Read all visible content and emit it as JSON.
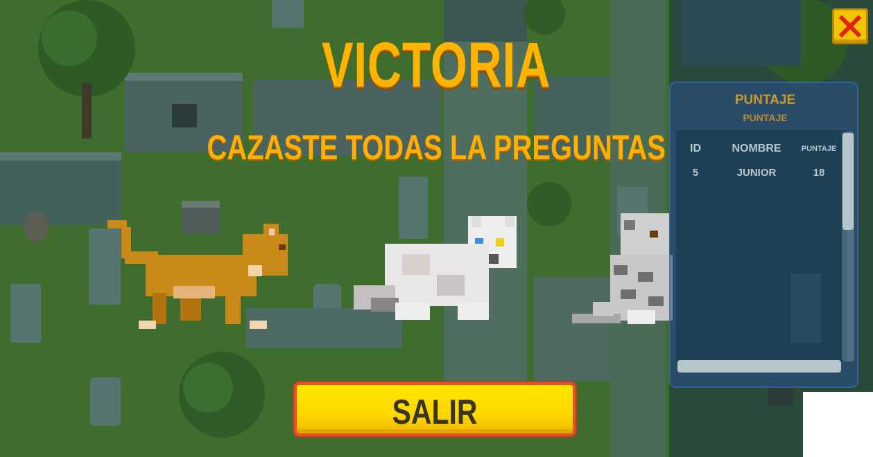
{
  "screen": {
    "title": "VICTORIA",
    "subtitle": "CAZASTE TODAS LA PREGUNTAS",
    "exit_label": "SALIR"
  },
  "close_button": {
    "icon": "close-icon",
    "color": "#f5c400",
    "x_color": "#e0201a"
  },
  "score_panel": {
    "title": "PUNTAJE",
    "subtitle": "PUNTAJE",
    "columns": [
      "ID",
      "NOMBRE",
      "PUNTAJE"
    ],
    "rows": [
      {
        "id": "5",
        "nombre": "JUNIOR",
        "puntaje": "18"
      }
    ]
  },
  "characters": [
    "orange-cat",
    "white-cat",
    "gray-tabby-cat"
  ],
  "colors": {
    "title": "#ffb400",
    "exit_button": "#ffe000",
    "exit_border": "#e2552b",
    "grass": "#3d6b2c"
  }
}
